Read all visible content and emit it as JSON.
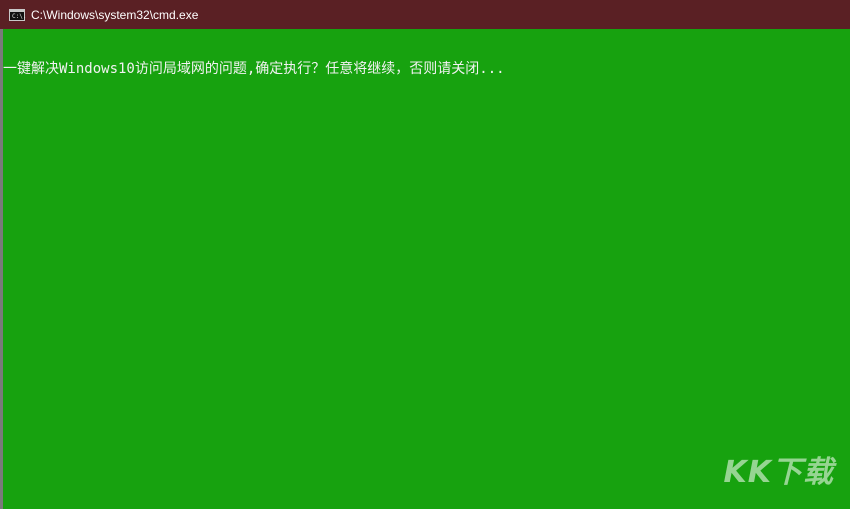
{
  "window": {
    "title": "C:\\Windows\\system32\\cmd.exe",
    "icon": "cmd-icon",
    "icon_glyph": "C:\\."
  },
  "console": {
    "output_line": "一键解决Windows10访问局域网的问题,确定执行？任意将继续，否则请关闭..."
  },
  "watermark": {
    "text": "KK下载"
  },
  "colors": {
    "titlebar": "#5a2024",
    "console_background": "#17a20f",
    "console_text": "#f2f2f2"
  }
}
